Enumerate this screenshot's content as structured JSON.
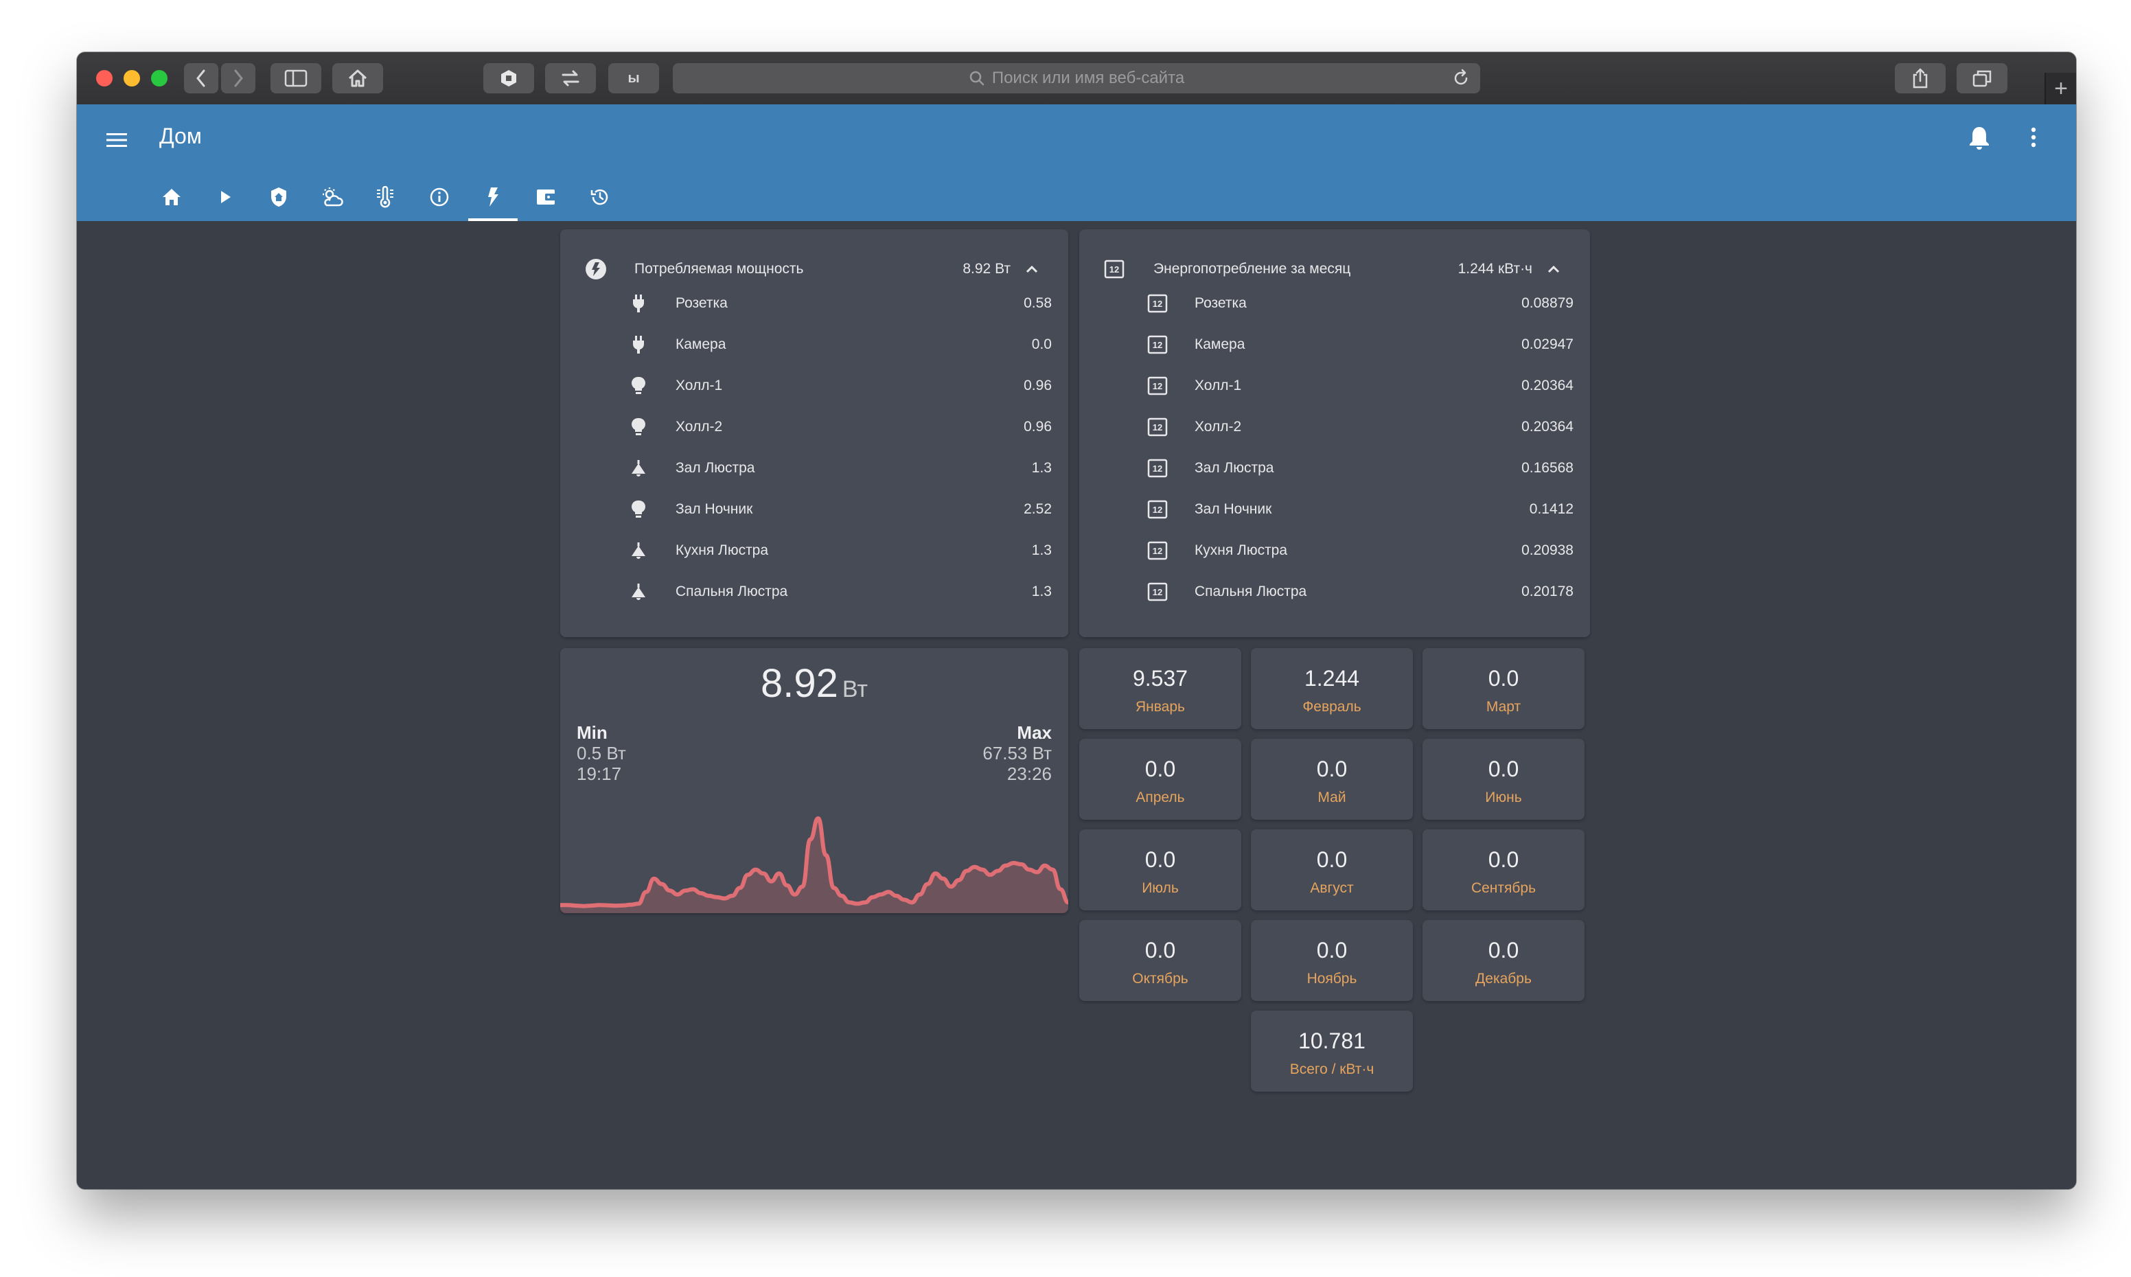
{
  "browser": {
    "url_placeholder": "Поиск или имя веб-сайта",
    "ext_label": "ы"
  },
  "app": {
    "title": "Дом",
    "accent": "#3e7fb5",
    "background": "#3a3e47",
    "card_color": "#474b55",
    "label_color": "#e6a45e",
    "graph_color": "#e06e75"
  },
  "tabs": [
    {
      "icon": "home-icon"
    },
    {
      "icon": "play-icon"
    },
    {
      "icon": "shield-home-icon"
    },
    {
      "icon": "weather-partly-cloudy-icon"
    },
    {
      "icon": "thermometer-lines-icon"
    },
    {
      "icon": "information-icon"
    },
    {
      "icon": "flash-icon",
      "active": true
    },
    {
      "icon": "wallet-icon"
    },
    {
      "icon": "history-icon"
    }
  ],
  "power_card": {
    "title": "Потребляемая мощность",
    "value": "8.92 Вт",
    "rows": [
      {
        "label": "Розетка",
        "value": "0.58",
        "icon": "power-plug-icon"
      },
      {
        "label": "Камера",
        "value": "0.0",
        "icon": "power-plug-icon"
      },
      {
        "label": "Холл-1",
        "value": "0.96",
        "icon": "lightbulb-icon"
      },
      {
        "label": "Холл-2",
        "value": "0.96",
        "icon": "lightbulb-icon"
      },
      {
        "label": "Зал Люстра",
        "value": "1.3",
        "icon": "ceiling-light-icon"
      },
      {
        "label": "Зал Ночник",
        "value": "2.52",
        "icon": "lightbulb-icon"
      },
      {
        "label": "Кухня Люстра",
        "value": "1.3",
        "icon": "ceiling-light-icon"
      },
      {
        "label": "Спальня Люстра",
        "value": "1.3",
        "icon": "ceiling-light-icon"
      }
    ]
  },
  "energy_card": {
    "title": "Энергопотребление за месяц",
    "value": "1.244 кВт·ч",
    "rows": [
      {
        "label": "Розетка",
        "value": "0.08879",
        "icon": "counter-icon"
      },
      {
        "label": "Камера",
        "value": "0.02947",
        "icon": "counter-icon"
      },
      {
        "label": "Холл-1",
        "value": "0.20364",
        "icon": "counter-icon"
      },
      {
        "label": "Холл-2",
        "value": "0.20364",
        "icon": "counter-icon"
      },
      {
        "label": "Зал Люстра",
        "value": "0.16568",
        "icon": "counter-icon"
      },
      {
        "label": "Зал Ночник",
        "value": "0.1412",
        "icon": "counter-icon"
      },
      {
        "label": "Кухня Люстра",
        "value": "0.20938",
        "icon": "counter-icon"
      },
      {
        "label": "Спальня Люстра",
        "value": "0.20178",
        "icon": "counter-icon"
      }
    ]
  },
  "graph_card": {
    "value": "8.92",
    "unit": "Вт",
    "min_label": "Min",
    "min_value": "0.5 Вт",
    "min_time": "19:17",
    "max_label": "Max",
    "max_value": "67.53 Вт",
    "max_time": "23:26",
    "points": [
      2,
      2,
      1.5,
      1.2,
      1.5,
      2,
      1.8,
      1.5,
      1.7,
      2.2,
      3,
      12,
      22,
      18,
      13,
      10,
      13,
      14,
      11,
      9,
      8,
      7,
      9,
      15,
      25,
      29,
      26,
      20,
      26,
      17,
      10,
      16,
      52,
      68,
      40,
      15,
      9,
      4,
      3,
      4,
      8,
      10,
      12,
      9,
      6,
      4,
      10,
      18,
      26,
      22,
      16,
      21,
      28,
      31,
      29,
      25,
      28,
      32,
      34,
      33,
      29,
      27,
      32,
      29,
      14,
      4
    ]
  },
  "months": [
    {
      "value": "9.537",
      "label": "Январь"
    },
    {
      "value": "1.244",
      "label": "Февраль"
    },
    {
      "value": "0.0",
      "label": "Март"
    },
    {
      "value": "0.0",
      "label": "Апрель"
    },
    {
      "value": "0.0",
      "label": "Май"
    },
    {
      "value": "0.0",
      "label": "Июнь"
    },
    {
      "value": "0.0",
      "label": "Июль"
    },
    {
      "value": "0.0",
      "label": "Август"
    },
    {
      "value": "0.0",
      "label": "Сентябрь"
    },
    {
      "value": "0.0",
      "label": "Октябрь"
    },
    {
      "value": "0.0",
      "label": "Ноябрь"
    },
    {
      "value": "0.0",
      "label": "Декабрь"
    }
  ],
  "total": {
    "value": "10.781",
    "label": "Всего / кВт·ч"
  }
}
